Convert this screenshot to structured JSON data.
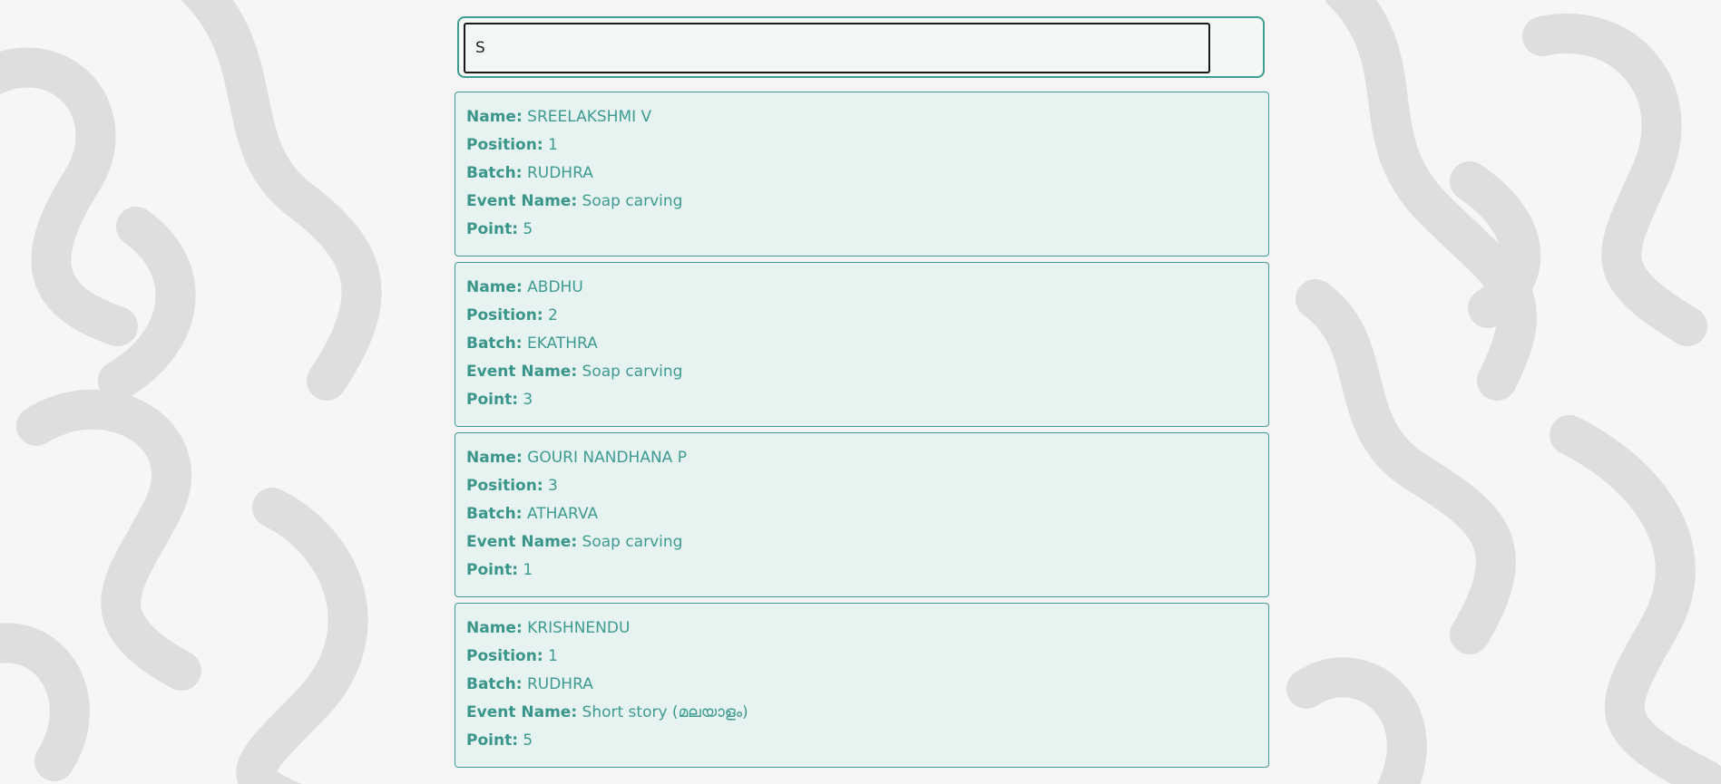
{
  "search": {
    "value": "S",
    "placeholder": ""
  },
  "labels": {
    "name": "Name:",
    "position": "Position:",
    "batch": "Batch:",
    "event": "Event Name:",
    "point": "Point:"
  },
  "results": [
    {
      "name": "SREELAKSHMI V",
      "position": "1",
      "batch": "RUDHRA",
      "event": "Soap carving",
      "point": "5"
    },
    {
      "name": "ABDHU",
      "position": "2",
      "batch": "EKATHRA",
      "event": "Soap carving",
      "point": "3"
    },
    {
      "name": "GOURI NANDHANA P",
      "position": "3",
      "batch": "ATHARVA",
      "event": "Soap carving",
      "point": "1"
    },
    {
      "name": "KRISHNENDU",
      "position": "1",
      "batch": "RUDHRA",
      "event": "Short story (മലയാളം)",
      "point": "5"
    }
  ],
  "colors": {
    "accent": "#3f9e92",
    "text": "#3e9b91",
    "card_bg": "#def2ee"
  }
}
